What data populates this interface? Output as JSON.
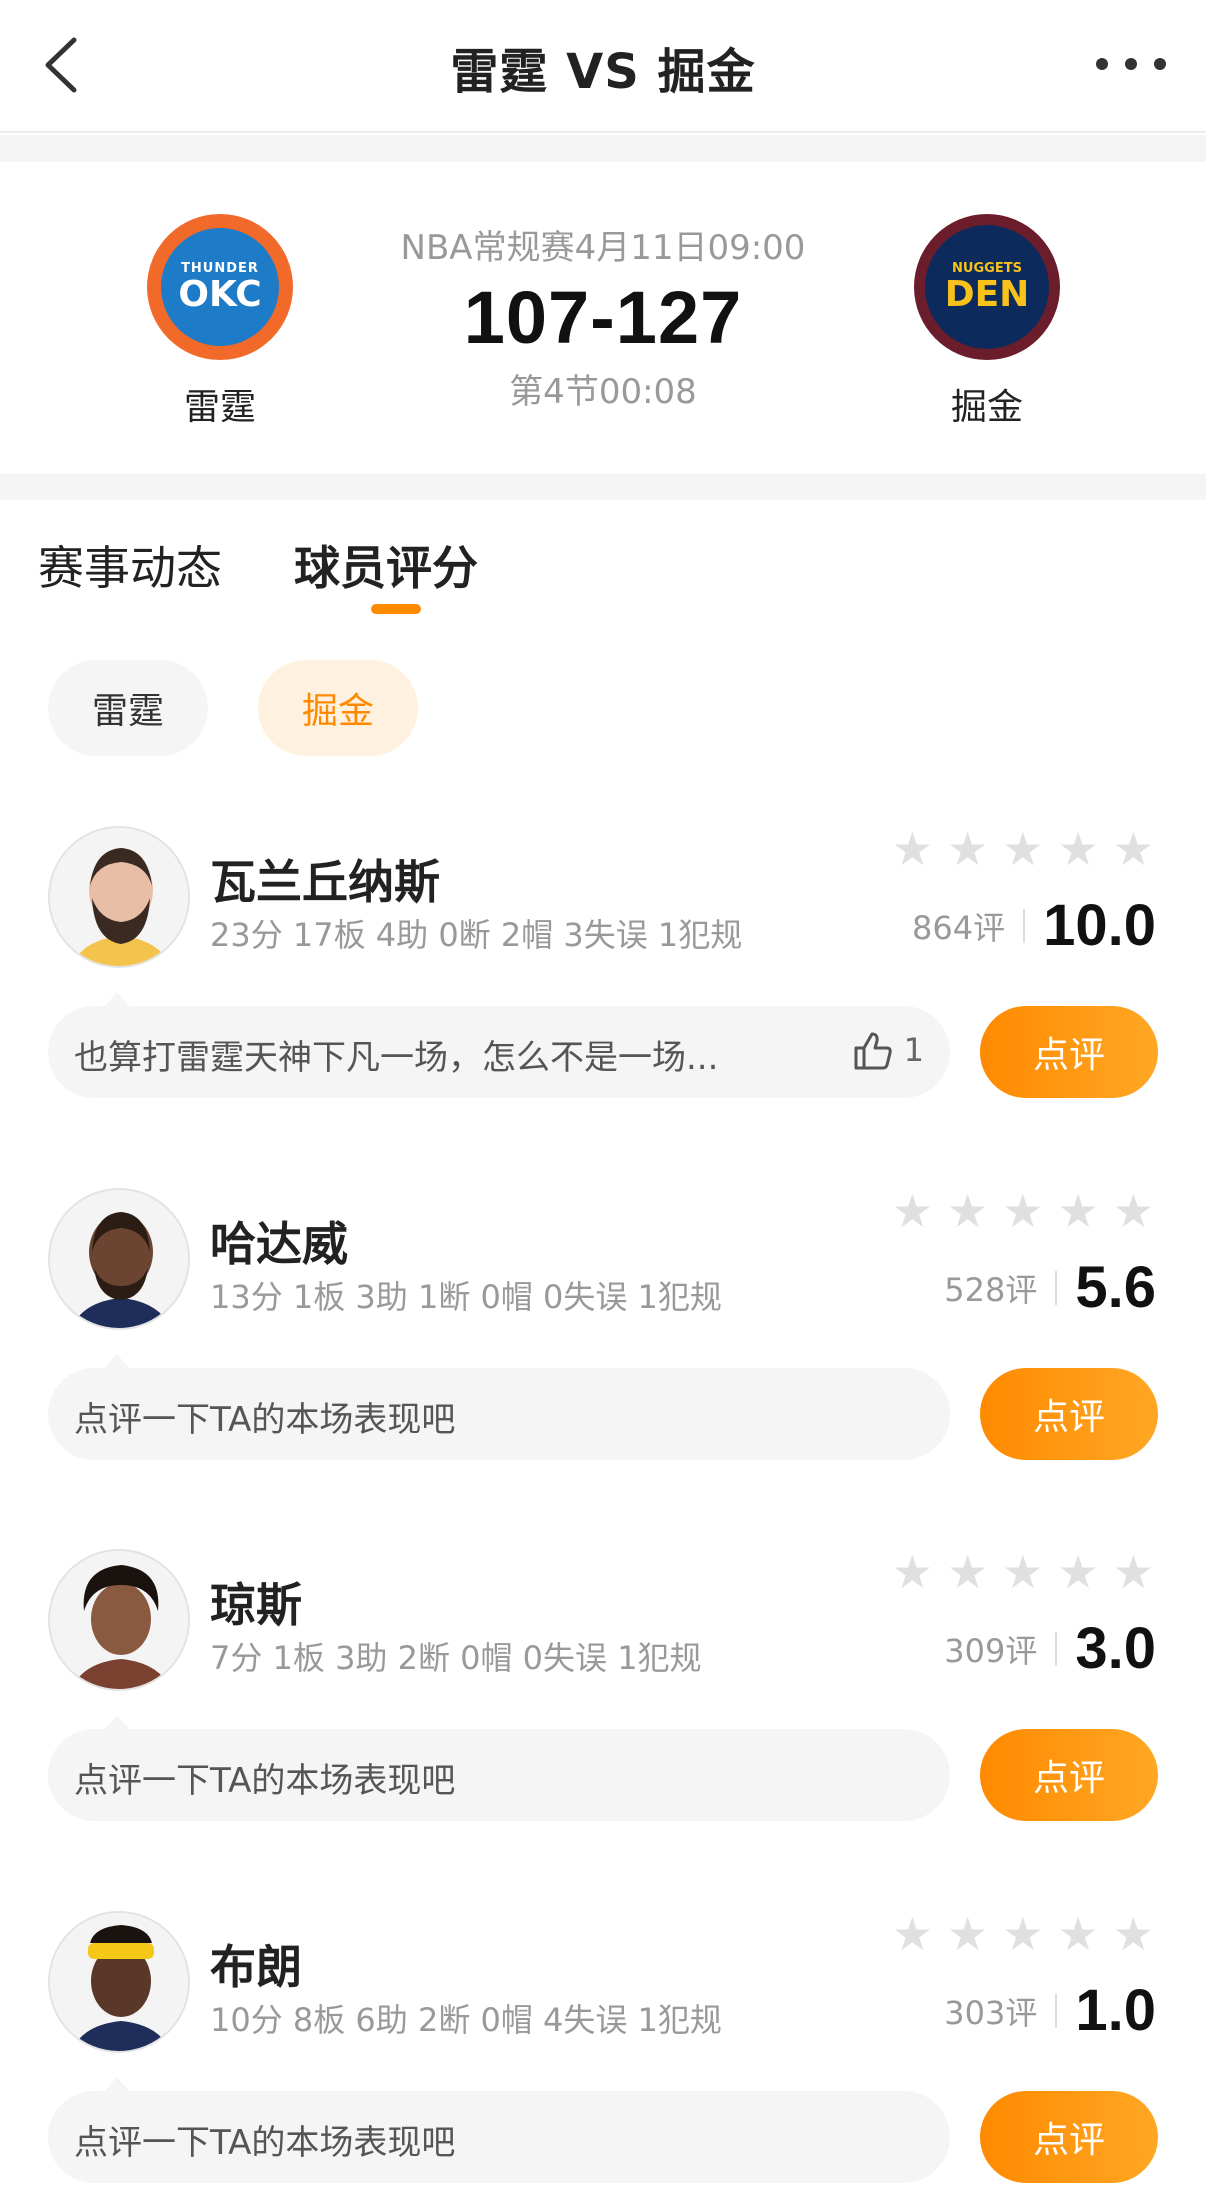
{
  "header": {
    "title": "雷霆 VS 掘金"
  },
  "scoreboard": {
    "home": {
      "name": "雷霆",
      "logo_small": "THUNDER",
      "logo_big": "OKC"
    },
    "away": {
      "name": "掘金",
      "logo_small": "NUGGETS",
      "logo_big": "DEN"
    },
    "match_info": "NBA常规赛4月11日09:00",
    "score": "107-127",
    "period": "第4节00:08"
  },
  "tabs": [
    {
      "label": "赛事动态",
      "active": false
    },
    {
      "label": "球员评分",
      "active": true
    }
  ],
  "filters": [
    {
      "label": "雷霆",
      "active": false
    },
    {
      "label": "掘金",
      "active": true
    }
  ],
  "players": [
    {
      "name": "瓦兰丘纳斯",
      "stats": "23分 17板 4助 0断 2帽 3失误 1犯规",
      "rating_count": "864评",
      "score": "10.0",
      "comment": "也算打雷霆天神下凡一场，怎么不是一场...",
      "likes": "1",
      "review_label": "点评"
    },
    {
      "name": "哈达威",
      "stats": "13分 1板 3助 1断 0帽 0失误 1犯规",
      "rating_count": "528评",
      "score": "5.6",
      "comment": "点评一下TA的本场表现吧",
      "review_label": "点评"
    },
    {
      "name": "琼斯",
      "stats": "7分 1板 3助 2断 0帽 0失误 1犯规",
      "rating_count": "309评",
      "score": "3.0",
      "comment": "点评一下TA的本场表现吧",
      "review_label": "点评"
    },
    {
      "name": "布朗",
      "stats": "10分 8板 6助 2断 0帽 4失误 1犯规",
      "rating_count": "303评",
      "score": "1.0",
      "comment": "点评一下TA的本场表现吧",
      "review_label": "点评"
    }
  ],
  "colors": {
    "accent": "#ff8a00",
    "star_empty": "#e0e0e0",
    "okc_orange": "#f26a2a",
    "okc_blue": "#1d7bc8",
    "den_navy": "#0d2a5c",
    "den_gold": "#f8c21a"
  }
}
